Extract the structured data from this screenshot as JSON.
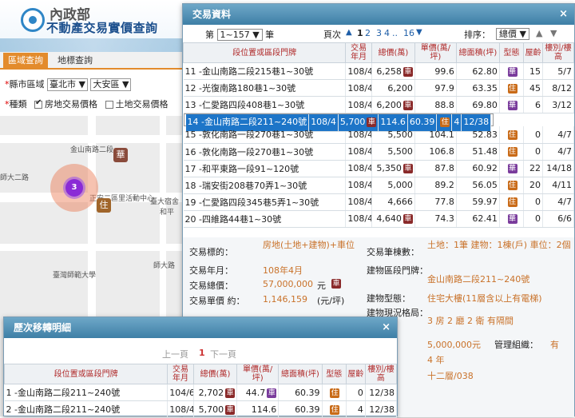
{
  "header": {
    "ministry": "內政部",
    "title": "不動產交易實價查詢"
  },
  "tabs": {
    "region": "區域查詢",
    "map": "地標查詢"
  },
  "filters": {
    "city_label": "縣市區域",
    "city_value": "臺北市",
    "district_value": "大安區",
    "type_label": "種類",
    "type_opt1": "房地交易價格",
    "type_opt2": "土地交易價格"
  },
  "map": {
    "road1": "金山南路二段",
    "road2": "師大二路",
    "place1": "正安二區里活動中心",
    "place2": "師大路",
    "place3": "臺灣師範大學",
    "place4": "和平",
    "place5": "臺大宿舍",
    "cluster_count": "3",
    "pin_hua": "華",
    "pin_zhu": "住"
  },
  "tx_panel": {
    "title": "交易資料",
    "close": "×",
    "page_prefix": "第",
    "page_select": "1~157 ▼",
    "page_suffix": "筆",
    "page_nav_label": "頁次",
    "pages": [
      "1",
      "2",
      "3",
      "4",
      "..",
      "16"
    ],
    "sort_label": "排序：",
    "sort_value": "總價 ▼",
    "columns": [
      "段位置或區段門牌",
      "交易年月",
      "總價(萬)",
      "單價(萬/坪)",
      "總面積(坪)",
      "型態",
      "屋齡",
      "樓別/樓高"
    ],
    "rows": [
      {
        "no": "11",
        "addr": "-金山南路二段215巷1~30號",
        "ym": "108/4",
        "total": "6,258",
        "unit": "99.6",
        "area": "62.80",
        "type": "華",
        "age": "15",
        "floor": "5/7",
        "total_badge": "車",
        "unit_badge": ""
      },
      {
        "no": "12",
        "addr": "-光復南路180巷1~30號",
        "ym": "108/4",
        "total": "6,200",
        "unit": "97.9",
        "area": "63.35",
        "type": "住",
        "age": "45",
        "floor": "8/12",
        "total_badge": "",
        "unit_badge": ""
      },
      {
        "no": "13",
        "addr": "-仁愛路四段408巷1~30號",
        "ym": "108/4",
        "total": "6,200",
        "unit": "88.8",
        "area": "69.80",
        "type": "華",
        "age": "6",
        "floor": "3/12",
        "total_badge": "車",
        "unit_badge": ""
      },
      {
        "no": "14",
        "addr": "-金山南路二段211~240號",
        "ym": "108/4",
        "total": "5,700",
        "unit": "114.6",
        "area": "60.39",
        "type": "住",
        "age": "4",
        "floor": "12/38",
        "total_badge": "車",
        "unit_badge": ""
      },
      {
        "no": "15",
        "addr": "-敦化南路一段270巷1~30號",
        "ym": "108/4",
        "total": "5,500",
        "unit": "104.1",
        "area": "52.83",
        "type": "住",
        "age": "0",
        "floor": "4/7",
        "total_badge": "",
        "unit_badge": ""
      },
      {
        "no": "16",
        "addr": "-敦化南路一段270巷1~30號",
        "ym": "108/4",
        "total": "5,500",
        "unit": "106.8",
        "area": "51.48",
        "type": "住",
        "age": "0",
        "floor": "4/7",
        "total_badge": "",
        "unit_badge": ""
      },
      {
        "no": "17",
        "addr": "-和平東路一段91~120號",
        "ym": "108/4",
        "total": "5,350",
        "unit": "87.8",
        "area": "60.92",
        "type": "華",
        "age": "22",
        "floor": "14/18",
        "total_badge": "車",
        "unit_badge": ""
      },
      {
        "no": "18",
        "addr": "-瑞安街208巷70弄1~30號",
        "ym": "108/4",
        "total": "5,000",
        "unit": "89.2",
        "area": "56.05",
        "type": "住",
        "age": "20",
        "floor": "4/11",
        "total_badge": "",
        "unit_badge": ""
      },
      {
        "no": "19",
        "addr": "-仁愛路四段345巷5弄1~30號",
        "ym": "108/4",
        "total": "4,666",
        "unit": "77.8",
        "area": "59.97",
        "type": "住",
        "age": "0",
        "floor": "4/7",
        "total_badge": "",
        "unit_badge": ""
      },
      {
        "no": "20",
        "addr": "-四維路44巷1~30號",
        "ym": "108/4",
        "total": "4,640",
        "unit": "74.3",
        "area": "62.41",
        "type": "華",
        "age": "0",
        "floor": "6/6",
        "total_badge": "車",
        "unit_badge": ""
      }
    ],
    "selected_row": 3
  },
  "detail": {
    "target_label": "交易標的：",
    "target_value": "房地(土地+建物)+車位",
    "ym_label": "交易年月：",
    "ym_value": "108年4月",
    "total_label": "交易總價：",
    "total_value": "57,000,000",
    "total_unit": "元",
    "unit_label": "交易單價 約：",
    "unit_value": "1,146,159",
    "unit_unit": "(元/坪)",
    "count_label": "交易筆棟數：",
    "count_value": "土地：1筆 建物：1棟(戶) 車位：2個",
    "addr_label": "建物區段門牌：",
    "addr_value": "金山南路二段211~240號",
    "btype_label": "建物型態：",
    "btype_value": "住宅大樓(11層含以上有電梯)",
    "layout_label": "建物現況格局：",
    "layout_value": "3 房 2 廳 2 衛 有隔間",
    "park_price": "5,000,000元",
    "mgmt_label": "管理組織：",
    "mgmt_value": "有",
    "age_value": "4 年",
    "floor_value": "十二層/038"
  },
  "history": {
    "title": "歷次移轉明細",
    "close": "×",
    "prev": "上一頁",
    "page": "1",
    "next": "下一頁",
    "columns": [
      "段位置或區段門牌",
      "交易年月",
      "總價(萬)",
      "單價(萬/坪)",
      "總面積(坪)",
      "型態",
      "屋齡",
      "樓別/樓高"
    ],
    "rows": [
      {
        "no": "1",
        "addr": "-金山南路二段211~240號",
        "ym": "104/6",
        "total": "2,702",
        "unit": "44.7",
        "area": "60.39",
        "type": "住",
        "age": "0",
        "floor": "12/38",
        "total_badge": "車",
        "unit_badge": "車"
      },
      {
        "no": "2",
        "addr": "-金山南路二段211~240號",
        "ym": "108/4",
        "total": "5,700",
        "unit": "114.6",
        "area": "60.39",
        "type": "住",
        "age": "4",
        "floor": "12/38",
        "total_badge": "車",
        "unit_badge": ""
      }
    ]
  }
}
